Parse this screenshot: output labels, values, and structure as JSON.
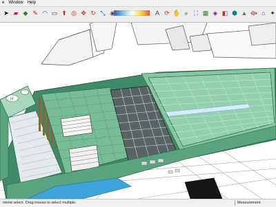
{
  "menubar": {
    "items": [
      "e",
      "Window",
      "Help"
    ]
  },
  "toolbar": {
    "icons": [
      "select-arrow-icon",
      "eraser-icon",
      "paint-bucket-icon",
      "line-pencil-icon",
      "arc-icon",
      "rectangle-icon",
      "push-pull-icon",
      "offset-icon",
      "move-icon",
      "rotate-icon",
      "scale-icon",
      "tape-measure-icon",
      "text-icon",
      "orbit-icon",
      "pan-icon",
      "zoom-icon",
      "zoom-extents-icon",
      "scenes-icon",
      "style-icon",
      "section-plane-icon",
      "component-icon",
      "sandbox-icon",
      "follow-me-icon",
      "warehouse-icon",
      "extension-icon"
    ],
    "color_bar_stops": [
      "#2e5fb8",
      "#8fd6e8",
      "#ffffff",
      "#ffd84d",
      "#e85a2a"
    ]
  },
  "statusbar": {
    "message": "nteral select. Drag mouse to select multiple.",
    "measurement_label": "Measurement"
  },
  "colors": {
    "roof_green": "#86c7a2",
    "deck_green": "#77bd98",
    "edge_green": "#2f6d52",
    "glass_blue": "#3ea3d8",
    "ground_line": "#9a9a9a"
  }
}
